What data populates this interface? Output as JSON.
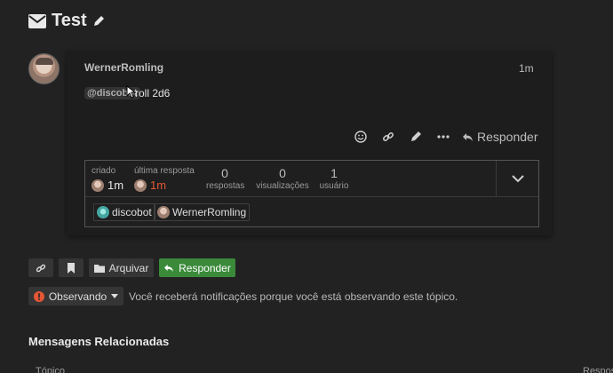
{
  "topic": {
    "title": "Test",
    "icon": "envelope-icon",
    "edit_icon": "pencil-icon"
  },
  "post": {
    "username": "WernerRomling",
    "age": "1m",
    "mention": "@discobot",
    "text": "roll 2d6",
    "actions": [
      "smile-icon",
      "link-icon",
      "pencil-icon",
      "ellipsis-icon"
    ],
    "reply_label": "Responder"
  },
  "topic_map": {
    "created_label": "criado",
    "created_value": "1m",
    "last_reply_label": "última resposta",
    "last_reply_value": "1m",
    "replies_num": "0",
    "replies_label": "respostas",
    "views_num": "0",
    "views_label": "visualizações",
    "users_num": "1",
    "users_label": "usuário",
    "participants": [
      "discobot",
      "WernerRomling"
    ]
  },
  "footer": {
    "archive_label": "Arquivar",
    "reply_label": "Responder",
    "notification_state": "Observando",
    "notification_text": "Você receberá notificações porque você está observando este tópico."
  },
  "related": {
    "title": "Mensagens Relacionadas",
    "col_topic": "Tópico",
    "col_replies": "Respos"
  },
  "colors": {
    "background": "#222222",
    "primary_button": "#3a8a3a",
    "alert_red": "#e45735"
  }
}
